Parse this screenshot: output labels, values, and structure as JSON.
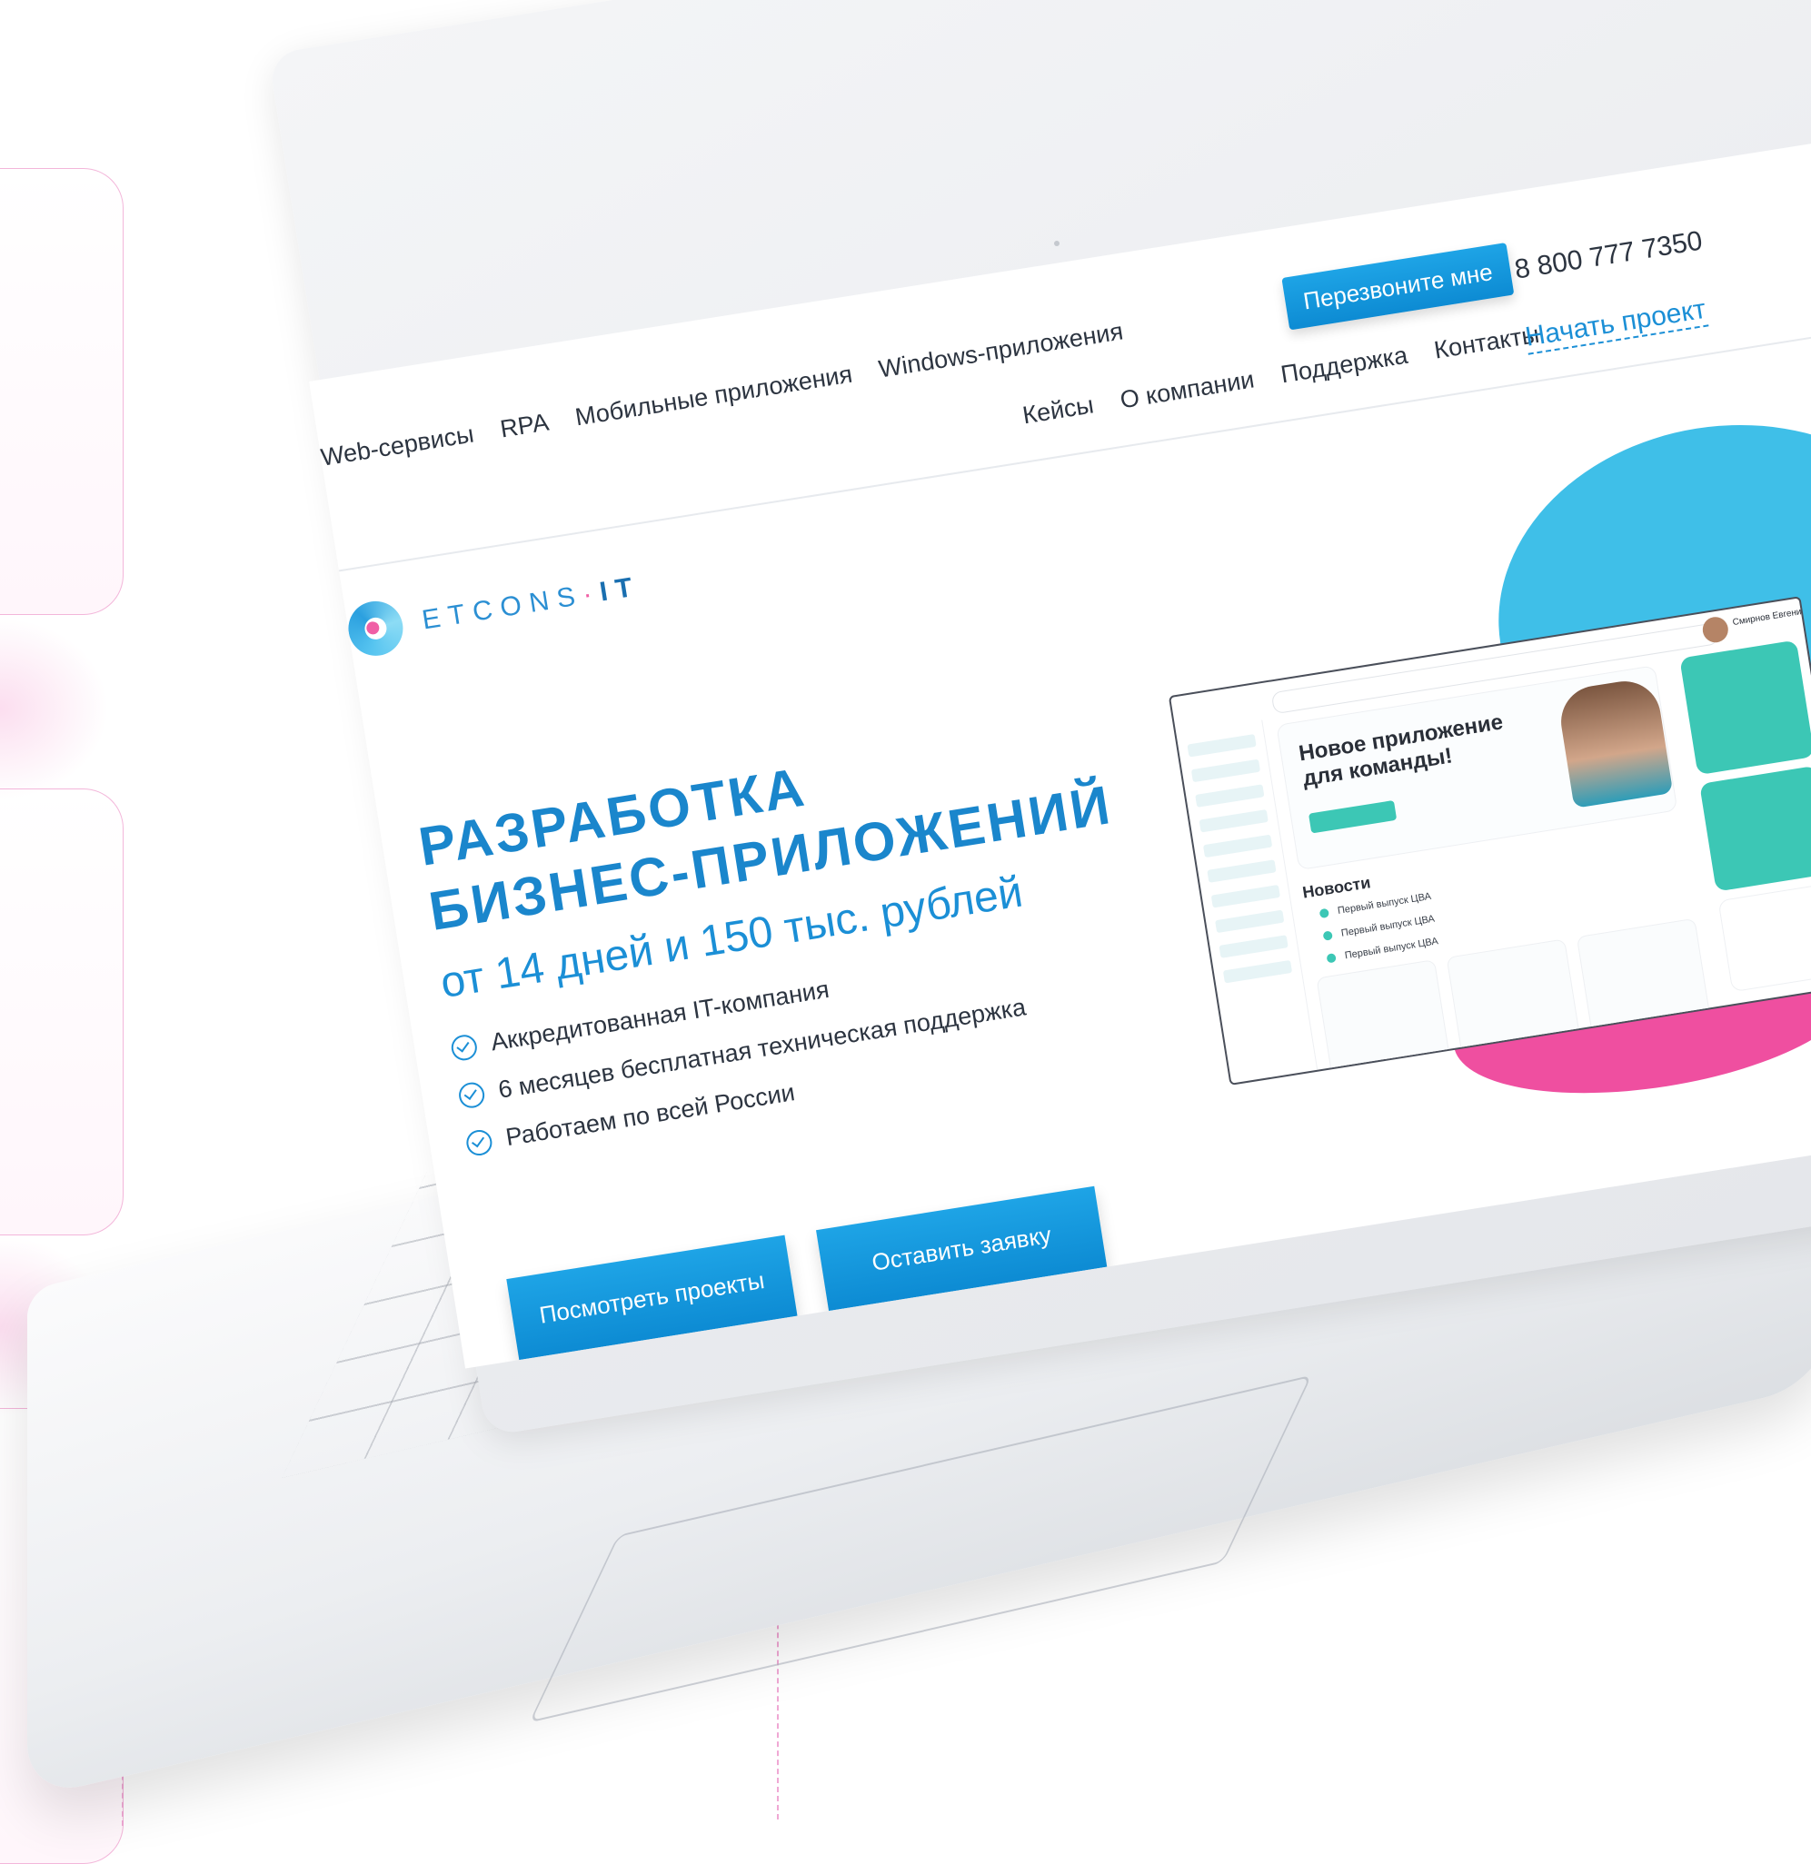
{
  "site": {
    "brand_logo": {
      "text_main": "ETCONS",
      "text_accent": "IT",
      "dot": "·"
    },
    "top_nav": [
      {
        "label": "Web-сервисы"
      },
      {
        "label": "RPA"
      },
      {
        "label": "Мобильные приложения"
      },
      {
        "label": "Windows-приложения"
      }
    ],
    "callback_button": "Перезвоните мне",
    "phone": "8 800 777 7350",
    "sub_nav": [
      {
        "label": "Кейсы"
      },
      {
        "label": "О компании"
      },
      {
        "label": "Поддержка"
      },
      {
        "label": "Контакты"
      }
    ],
    "start_project": "Начать проект"
  },
  "hero": {
    "title_line1": "РАЗРАБОТКА",
    "title_line2": "БИЗНЕС-ПРИЛОЖЕНИЙ",
    "subtitle": "от 14 дней и 150 тыс. рублей",
    "bullets": [
      "Аккредитованная IT-компания",
      "6 месяцев бесплатная техническая поддержка",
      "Работаем по всей России"
    ],
    "button_projects": "Посмотреть проекты",
    "button_request": "Оставить заявку"
  },
  "mockup": {
    "user_name": "Смирнов Евгений",
    "card_title": "Новое приложение для команды!",
    "news_title": "Новости",
    "news_items": [
      "Первый выпуск ЦВА",
      "Первый выпуск ЦВА",
      "Первый выпуск ЦВА"
    ]
  },
  "colors": {
    "accent_blue": "#1b8fd6",
    "accent_pink": "#ef4fa0",
    "accent_teal": "#3cc7b5"
  }
}
